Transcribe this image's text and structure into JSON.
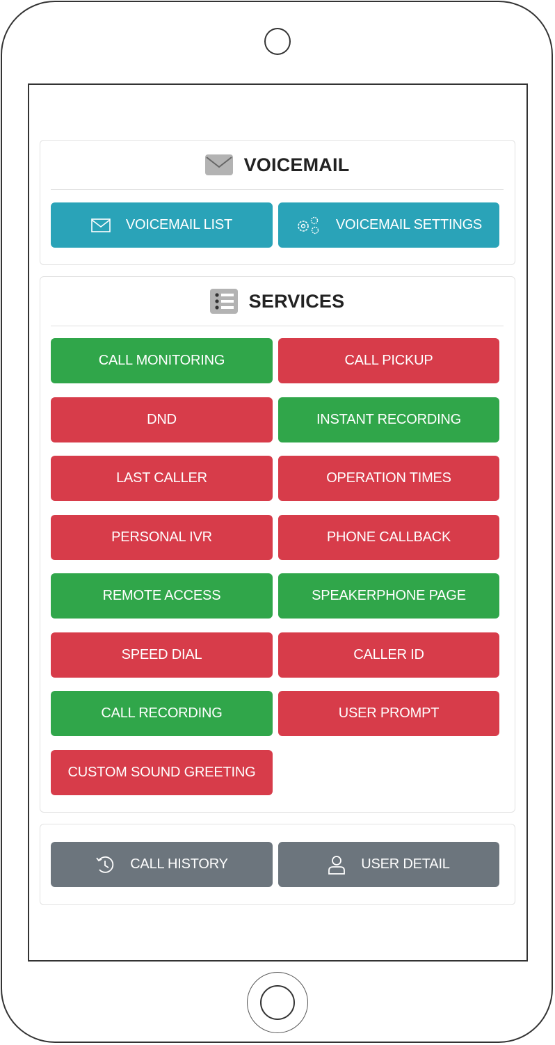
{
  "voicemail": {
    "title": "VOICEMAIL",
    "title_icon": "envelope-icon",
    "buttons": [
      {
        "label": "VOICEMAIL LIST",
        "icon": "envelope-icon",
        "color": "#2aa3b8"
      },
      {
        "label": "VOICEMAIL SETTINGS",
        "icon": "gears-icon",
        "color": "#2aa3b8"
      }
    ]
  },
  "services": {
    "title": "SERVICES",
    "title_icon": "list-icon",
    "status_colors": {
      "enabled": "#30a64a",
      "disabled": "#d73c4a"
    },
    "items": [
      {
        "label": "CALL MONITORING",
        "status": "enabled"
      },
      {
        "label": "CALL PICKUP",
        "status": "disabled"
      },
      {
        "label": "DND",
        "status": "disabled"
      },
      {
        "label": "INSTANT RECORDING",
        "status": "enabled"
      },
      {
        "label": "LAST CALLER",
        "status": "disabled"
      },
      {
        "label": "OPERATION TIMES",
        "status": "disabled"
      },
      {
        "label": "PERSONAL IVR",
        "status": "disabled"
      },
      {
        "label": "PHONE CALLBACK",
        "status": "disabled"
      },
      {
        "label": "REMOTE ACCESS",
        "status": "enabled"
      },
      {
        "label": "SPEAKERPHONE PAGE",
        "status": "enabled"
      },
      {
        "label": "SPEED DIAL",
        "status": "disabled"
      },
      {
        "label": "CALLER ID",
        "status": "disabled"
      },
      {
        "label": "CALL RECORDING",
        "status": "enabled"
      },
      {
        "label": "USER PROMPT",
        "status": "disabled"
      },
      {
        "label": "CUSTOM SOUND GREETING",
        "status": "disabled"
      }
    ]
  },
  "footer": {
    "buttons": [
      {
        "label": "CALL HISTORY",
        "icon": "history-icon",
        "color": "#6c757d"
      },
      {
        "label": "USER DETAIL",
        "icon": "user-icon",
        "color": "#6c757d"
      }
    ]
  }
}
